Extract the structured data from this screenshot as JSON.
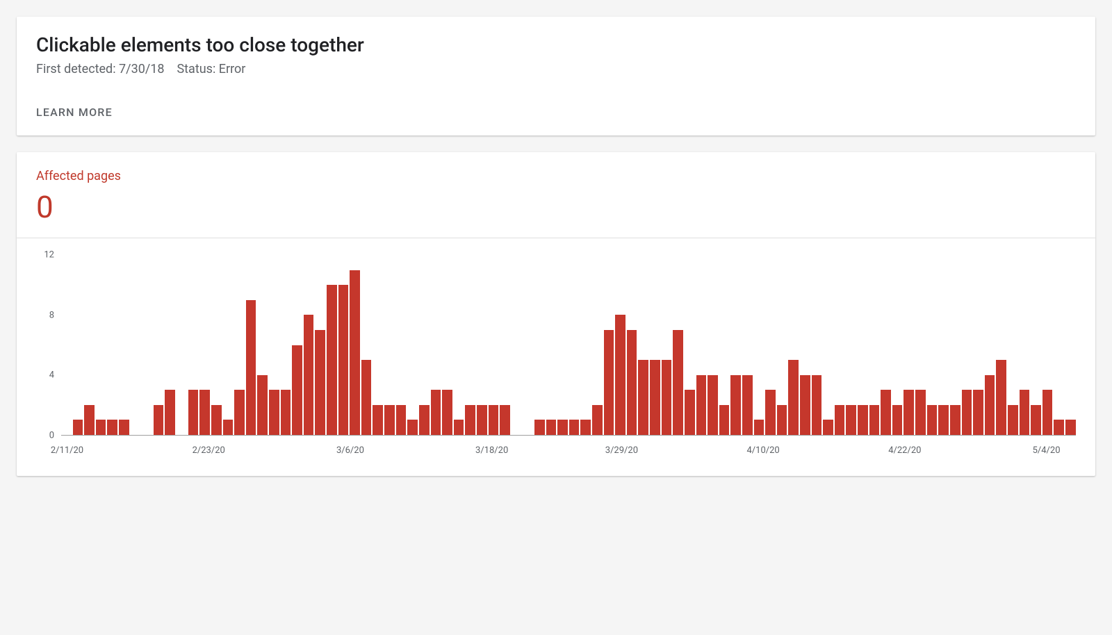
{
  "header": {
    "title": "Clickable elements too close together",
    "first_detected_label": "First detected:",
    "first_detected_value": "7/30/18",
    "status_label": "Status:",
    "status_value": "Error",
    "learn_more": "LEARN MORE"
  },
  "metric": {
    "label": "Affected pages",
    "value": "0"
  },
  "chart_data": {
    "type": "bar",
    "title": "Affected pages",
    "xlabel": "",
    "ylabel": "",
    "ylim": [
      0,
      12
    ],
    "y_ticks": [
      0,
      4,
      8,
      12
    ],
    "x_tick_labels": [
      "2/11/20",
      "2/23/20",
      "3/6/20",
      "3/18/20",
      "3/29/20",
      "4/10/20",
      "4/22/20",
      "5/4/20"
    ],
    "categories": [
      "2/11/20",
      "2/12/20",
      "2/13/20",
      "2/14/20",
      "2/15/20",
      "2/16/20",
      "2/17/20",
      "2/18/20",
      "2/19/20",
      "2/20/20",
      "2/21/20",
      "2/22/20",
      "2/23/20",
      "2/24/20",
      "2/25/20",
      "2/26/20",
      "2/27/20",
      "2/28/20",
      "2/29/20",
      "3/1/20",
      "3/2/20",
      "3/3/20",
      "3/4/20",
      "3/5/20",
      "3/6/20",
      "3/7/20",
      "3/8/20",
      "3/9/20",
      "3/10/20",
      "3/11/20",
      "3/12/20",
      "3/13/20",
      "3/14/20",
      "3/15/20",
      "3/16/20",
      "3/17/20",
      "3/18/20",
      "3/19/20",
      "3/20/20",
      "3/21/20",
      "3/22/20",
      "3/23/20",
      "3/24/20",
      "3/25/20",
      "3/26/20",
      "3/27/20",
      "3/28/20",
      "3/29/20",
      "3/30/20",
      "3/31/20",
      "4/1/20",
      "4/2/20",
      "4/3/20",
      "4/4/20",
      "4/5/20",
      "4/6/20",
      "4/7/20",
      "4/8/20",
      "4/9/20",
      "4/10/20",
      "4/11/20",
      "4/12/20",
      "4/13/20",
      "4/14/20",
      "4/15/20",
      "4/16/20",
      "4/17/20",
      "4/18/20",
      "4/19/20",
      "4/20/20",
      "4/21/20",
      "4/22/20",
      "4/23/20",
      "4/24/20",
      "4/25/20",
      "4/26/20",
      "4/27/20",
      "4/28/20",
      "4/29/20",
      "4/30/20",
      "5/1/20",
      "5/2/20",
      "5/3/20",
      "5/4/20",
      "5/5/20",
      "5/6/20"
    ],
    "values": [
      0,
      1,
      2,
      1,
      1,
      1,
      0,
      0,
      2,
      3,
      0,
      3,
      3,
      2,
      1,
      3,
      9,
      4,
      3,
      3,
      6,
      8,
      7,
      10,
      10,
      11,
      5,
      2,
      2,
      2,
      1,
      2,
      3,
      3,
      1,
      2,
      2,
      2,
      2,
      0,
      0,
      1,
      1,
      1,
      1,
      1,
      2,
      7,
      8,
      7,
      5,
      5,
      5,
      7,
      3,
      4,
      4,
      2,
      4,
      4,
      1,
      3,
      2,
      5,
      4,
      4,
      1,
      2,
      2,
      2,
      2,
      3,
      2,
      3,
      3,
      2,
      2,
      2,
      3,
      3,
      4,
      5,
      2,
      3,
      2,
      3,
      1,
      1
    ],
    "bar_color": "#c5372c"
  }
}
